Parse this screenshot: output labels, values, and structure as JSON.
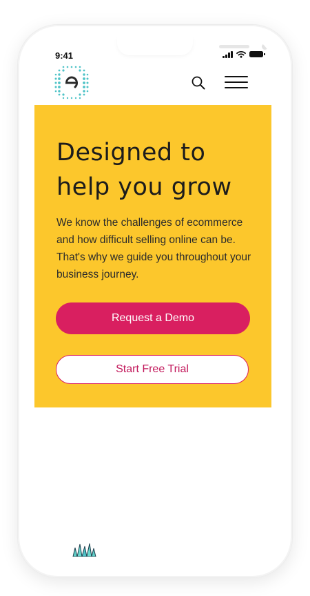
{
  "status_bar": {
    "time": "9:41",
    "icons": [
      "signal-icon",
      "wifi-icon",
      "battery-icon"
    ]
  },
  "header": {
    "logo_icon": "e-logo-icon",
    "search_icon": "search-icon",
    "menu_icon": "hamburger-menu-icon"
  },
  "hero": {
    "title_line1": "Designed to",
    "title_line2": "help you grow",
    "description": "We know the challenges of ecommerce and how difficult selling online can be. That's why we guide you throughout your business journey.",
    "primary_button": "Request a Demo",
    "secondary_button": "Start Free Trial",
    "background_color": "#fcc72c"
  },
  "colors": {
    "accent": "#d91f60",
    "logo_dots": "#4fc3c7",
    "text": "#1c1c1c"
  }
}
